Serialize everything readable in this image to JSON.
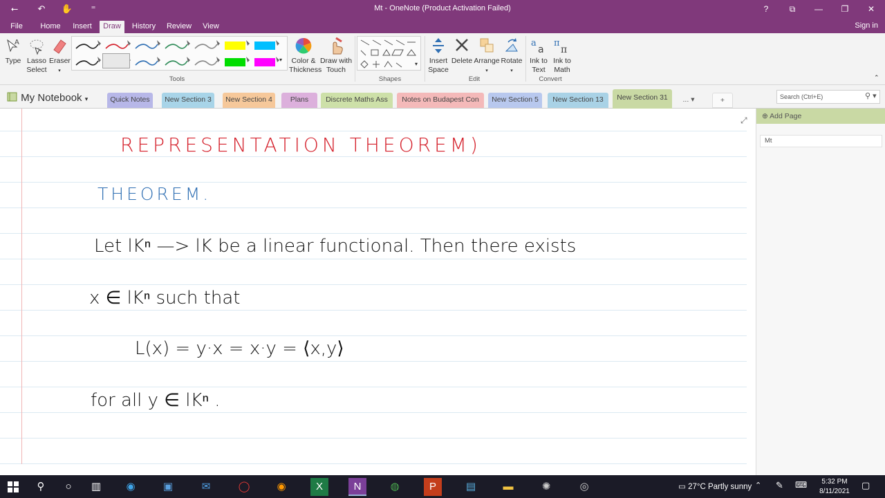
{
  "app": {
    "title": "Mt - OneNote (Product Activation Failed)",
    "signin": "Sign in",
    "help": "?",
    "restore_ribbon": "⧉",
    "minimize": "—",
    "maximize": "❐",
    "close": "✕"
  },
  "quick_access": {
    "back": "⭠",
    "undo": "↶",
    "touch": "✋",
    "more": "⁼"
  },
  "ribbon_tabs": [
    "File",
    "Home",
    "Insert",
    "Draw",
    "History",
    "Review",
    "View"
  ],
  "active_tab": "Draw",
  "ribbon": {
    "tools": {
      "type": "Type",
      "lasso_1": "Lasso",
      "lasso_2": "Select",
      "eraser": "Eraser",
      "group": "Tools",
      "color_1": "Color &",
      "color_2": "Thickness",
      "touch_1": "Draw with",
      "touch_2": "Touch"
    },
    "shapes": {
      "group": "Shapes"
    },
    "edit": {
      "insert_1": "Insert",
      "insert_2": "Space",
      "delete": "Delete",
      "arrange": "Arrange",
      "rotate": "Rotate",
      "group": "Edit"
    },
    "convert": {
      "text_1": "Ink to",
      "text_2": "Text",
      "math_1": "Ink to",
      "math_2": "Math",
      "group": "Convert"
    },
    "pen_colors": [
      "#222222",
      "#d41f2a",
      "#2f6fb3",
      "#2e8b57",
      "#888888",
      "#ffff00",
      "#00bfff",
      "#222222",
      "#d41f2a",
      "#2f6fb3",
      "#2e8b57",
      "#888888",
      "#00dd00",
      "#ff00ff"
    ]
  },
  "notebook": {
    "name": "My Notebook"
  },
  "sections": [
    {
      "label": "Quick Notes",
      "color": "#b7b7e8"
    },
    {
      "label": "New Section 3",
      "color": "#a8d4e8"
    },
    {
      "label": "New Section 4",
      "color": "#f6c89a"
    },
    {
      "label": "Plans",
      "color": "#dcb0dc"
    },
    {
      "label": "Discrete Maths Ass",
      "color": "#cde0a8"
    },
    {
      "label": "Notes on Budapest Con",
      "color": "#f4b9b9"
    },
    {
      "label": "New Section 5",
      "color": "#b8c8ee"
    },
    {
      "label": "New Section 13",
      "color": "#a9d2e6"
    },
    {
      "label": "New Section 31",
      "color": "#c9d9a4"
    }
  ],
  "active_section": "New Section 31",
  "section_more": "...",
  "add_section": "+",
  "search": {
    "placeholder": "Search (Ctrl+E)"
  },
  "page_pane": {
    "add_page": "Add Page",
    "pages": [
      "Mt"
    ]
  },
  "ink": {
    "title": "REPRESENTATION THEOREM)",
    "heading": "THEOREM.",
    "line1": "Let lKⁿ —> lK  be  a  linear  functional. Then there exists",
    "line2": "x ∈ lKⁿ such that",
    "line3": "L(x) = y·x = x·y  = ⟨x,y⟩",
    "line4": "for all  y ∈ lKⁿ ."
  },
  "taskbar": {
    "weather": "27°C  Partly sunny",
    "time": "5:32 PM",
    "date": "8/11/2021"
  }
}
